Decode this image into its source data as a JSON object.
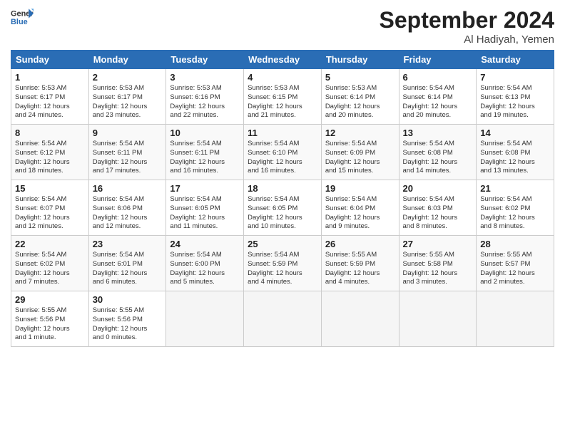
{
  "header": {
    "logo_general": "General",
    "logo_blue": "Blue",
    "month": "September 2024",
    "location": "Al Hadiyah, Yemen"
  },
  "weekdays": [
    "Sunday",
    "Monday",
    "Tuesday",
    "Wednesday",
    "Thursday",
    "Friday",
    "Saturday"
  ],
  "weeks": [
    [
      {
        "day": "1",
        "lines": [
          "Sunrise: 5:53 AM",
          "Sunset: 6:17 PM",
          "Daylight: 12 hours",
          "and 24 minutes."
        ]
      },
      {
        "day": "2",
        "lines": [
          "Sunrise: 5:53 AM",
          "Sunset: 6:17 PM",
          "Daylight: 12 hours",
          "and 23 minutes."
        ]
      },
      {
        "day": "3",
        "lines": [
          "Sunrise: 5:53 AM",
          "Sunset: 6:16 PM",
          "Daylight: 12 hours",
          "and 22 minutes."
        ]
      },
      {
        "day": "4",
        "lines": [
          "Sunrise: 5:53 AM",
          "Sunset: 6:15 PM",
          "Daylight: 12 hours",
          "and 21 minutes."
        ]
      },
      {
        "day": "5",
        "lines": [
          "Sunrise: 5:53 AM",
          "Sunset: 6:14 PM",
          "Daylight: 12 hours",
          "and 20 minutes."
        ]
      },
      {
        "day": "6",
        "lines": [
          "Sunrise: 5:54 AM",
          "Sunset: 6:14 PM",
          "Daylight: 12 hours",
          "and 20 minutes."
        ]
      },
      {
        "day": "7",
        "lines": [
          "Sunrise: 5:54 AM",
          "Sunset: 6:13 PM",
          "Daylight: 12 hours",
          "and 19 minutes."
        ]
      }
    ],
    [
      {
        "day": "8",
        "lines": [
          "Sunrise: 5:54 AM",
          "Sunset: 6:12 PM",
          "Daylight: 12 hours",
          "and 18 minutes."
        ]
      },
      {
        "day": "9",
        "lines": [
          "Sunrise: 5:54 AM",
          "Sunset: 6:11 PM",
          "Daylight: 12 hours",
          "and 17 minutes."
        ]
      },
      {
        "day": "10",
        "lines": [
          "Sunrise: 5:54 AM",
          "Sunset: 6:11 PM",
          "Daylight: 12 hours",
          "and 16 minutes."
        ]
      },
      {
        "day": "11",
        "lines": [
          "Sunrise: 5:54 AM",
          "Sunset: 6:10 PM",
          "Daylight: 12 hours",
          "and 16 minutes."
        ]
      },
      {
        "day": "12",
        "lines": [
          "Sunrise: 5:54 AM",
          "Sunset: 6:09 PM",
          "Daylight: 12 hours",
          "and 15 minutes."
        ]
      },
      {
        "day": "13",
        "lines": [
          "Sunrise: 5:54 AM",
          "Sunset: 6:08 PM",
          "Daylight: 12 hours",
          "and 14 minutes."
        ]
      },
      {
        "day": "14",
        "lines": [
          "Sunrise: 5:54 AM",
          "Sunset: 6:08 PM",
          "Daylight: 12 hours",
          "and 13 minutes."
        ]
      }
    ],
    [
      {
        "day": "15",
        "lines": [
          "Sunrise: 5:54 AM",
          "Sunset: 6:07 PM",
          "Daylight: 12 hours",
          "and 12 minutes."
        ]
      },
      {
        "day": "16",
        "lines": [
          "Sunrise: 5:54 AM",
          "Sunset: 6:06 PM",
          "Daylight: 12 hours",
          "and 12 minutes."
        ]
      },
      {
        "day": "17",
        "lines": [
          "Sunrise: 5:54 AM",
          "Sunset: 6:05 PM",
          "Daylight: 12 hours",
          "and 11 minutes."
        ]
      },
      {
        "day": "18",
        "lines": [
          "Sunrise: 5:54 AM",
          "Sunset: 6:05 PM",
          "Daylight: 12 hours",
          "and 10 minutes."
        ]
      },
      {
        "day": "19",
        "lines": [
          "Sunrise: 5:54 AM",
          "Sunset: 6:04 PM",
          "Daylight: 12 hours",
          "and 9 minutes."
        ]
      },
      {
        "day": "20",
        "lines": [
          "Sunrise: 5:54 AM",
          "Sunset: 6:03 PM",
          "Daylight: 12 hours",
          "and 8 minutes."
        ]
      },
      {
        "day": "21",
        "lines": [
          "Sunrise: 5:54 AM",
          "Sunset: 6:02 PM",
          "Daylight: 12 hours",
          "and 8 minutes."
        ]
      }
    ],
    [
      {
        "day": "22",
        "lines": [
          "Sunrise: 5:54 AM",
          "Sunset: 6:02 PM",
          "Daylight: 12 hours",
          "and 7 minutes."
        ]
      },
      {
        "day": "23",
        "lines": [
          "Sunrise: 5:54 AM",
          "Sunset: 6:01 PM",
          "Daylight: 12 hours",
          "and 6 minutes."
        ]
      },
      {
        "day": "24",
        "lines": [
          "Sunrise: 5:54 AM",
          "Sunset: 6:00 PM",
          "Daylight: 12 hours",
          "and 5 minutes."
        ]
      },
      {
        "day": "25",
        "lines": [
          "Sunrise: 5:54 AM",
          "Sunset: 5:59 PM",
          "Daylight: 12 hours",
          "and 4 minutes."
        ]
      },
      {
        "day": "26",
        "lines": [
          "Sunrise: 5:55 AM",
          "Sunset: 5:59 PM",
          "Daylight: 12 hours",
          "and 4 minutes."
        ]
      },
      {
        "day": "27",
        "lines": [
          "Sunrise: 5:55 AM",
          "Sunset: 5:58 PM",
          "Daylight: 12 hours",
          "and 3 minutes."
        ]
      },
      {
        "day": "28",
        "lines": [
          "Sunrise: 5:55 AM",
          "Sunset: 5:57 PM",
          "Daylight: 12 hours",
          "and 2 minutes."
        ]
      }
    ],
    [
      {
        "day": "29",
        "lines": [
          "Sunrise: 5:55 AM",
          "Sunset: 5:56 PM",
          "Daylight: 12 hours",
          "and 1 minute."
        ]
      },
      {
        "day": "30",
        "lines": [
          "Sunrise: 5:55 AM",
          "Sunset: 5:56 PM",
          "Daylight: 12 hours",
          "and 0 minutes."
        ]
      },
      null,
      null,
      null,
      null,
      null
    ]
  ]
}
